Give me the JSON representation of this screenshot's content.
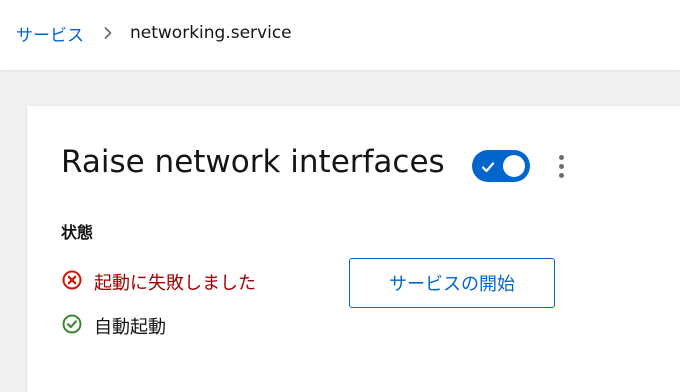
{
  "breadcrumb": {
    "parent": "サービス",
    "current": "networking.service"
  },
  "card": {
    "title": "Raise network interfaces",
    "toggle": {
      "state": "on",
      "color": "#0066cc"
    },
    "status_label": "状態",
    "status": {
      "failed_text": "起動に失敗しました",
      "enabled_text": "自動起動"
    },
    "start_button_label": "サービスの開始"
  },
  "colors": {
    "accent": "#0066cc",
    "error": "#c9190b",
    "success": "#3e8635"
  }
}
